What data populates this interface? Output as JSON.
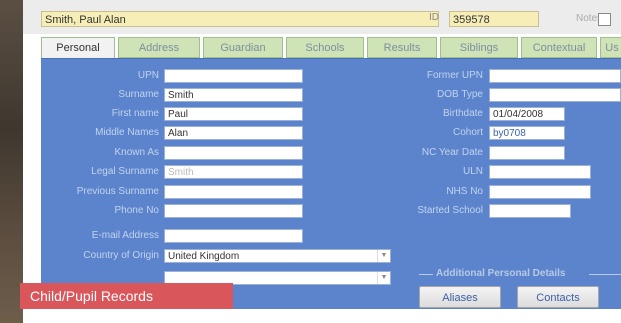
{
  "header": {
    "student_name": "Smith, Paul Alan",
    "id_label": "ID",
    "id_value": "359578",
    "notes_label": "Notes"
  },
  "tabs": [
    {
      "label": "Personal",
      "active": true
    },
    {
      "label": "Address",
      "active": false
    },
    {
      "label": "Guardian",
      "active": false
    },
    {
      "label": "Schools",
      "active": false
    },
    {
      "label": "Results",
      "active": false
    },
    {
      "label": "Siblings",
      "active": false
    },
    {
      "label": "Contextual",
      "active": false
    },
    {
      "label": "Us",
      "active": false
    }
  ],
  "left_fields": [
    {
      "label": "UPN",
      "value": ""
    },
    {
      "label": "Surname",
      "value": "Smith"
    },
    {
      "label": "First name",
      "value": "Paul"
    },
    {
      "label": "Middle Names",
      "value": "Alan"
    },
    {
      "label": "Known As",
      "value": ""
    },
    {
      "label": "Legal Surname",
      "value": "Smith"
    },
    {
      "label": "Previous Surname",
      "value": ""
    },
    {
      "label": "Phone No",
      "value": ""
    },
    {
      "label": "E-mail Address",
      "value": ""
    },
    {
      "label": "Country of Origin",
      "value": "United Kingdom"
    },
    {
      "label": "",
      "value": ""
    }
  ],
  "right_fields": [
    {
      "label": "Former UPN",
      "value": ""
    },
    {
      "label": "DOB Type",
      "value": ""
    },
    {
      "label": "Birthdate",
      "value": "01/04/2008"
    },
    {
      "label": "Cohort",
      "value": "by0708"
    },
    {
      "label": "NC Year Date",
      "value": ""
    },
    {
      "label": "ULN",
      "value": ""
    },
    {
      "label": "NHS No",
      "value": ""
    },
    {
      "label": "Started School",
      "value": ""
    }
  ],
  "additional_section": {
    "title": "Additional Personal Details",
    "buttons": [
      "Aliases",
      "Contacts"
    ]
  },
  "caption": "Child/Pupil Records",
  "colors": {
    "panel": "#5b84cc",
    "tab": "#cfe3b6",
    "highlight_field": "#f7eeb7",
    "caption": "#d9565b"
  }
}
